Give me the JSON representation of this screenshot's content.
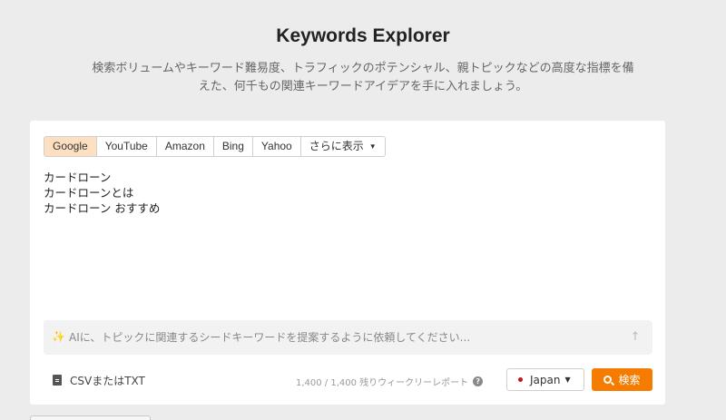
{
  "header": {
    "title": "Keywords Explorer",
    "subtitle_line1": "検索ボリュームやキーワード難易度、トラフィックのポテンシャル、親トピックなどの高度な指標を備",
    "subtitle_line2": "えた、何千もの関連キーワードアイデアを手に入れましょう。"
  },
  "search_engines": {
    "active": "Google",
    "tabs": [
      {
        "label": "Google"
      },
      {
        "label": "YouTube"
      },
      {
        "label": "Amazon"
      },
      {
        "label": "Bing"
      },
      {
        "label": "Yahoo"
      },
      {
        "label": "さらに表示"
      }
    ]
  },
  "keywords": [
    "カードローン",
    "カードローンとは",
    "カードローン おすすめ"
  ],
  "ai_prompt": {
    "placeholder": "AIに、トピックに関連するシードキーワードを提案するように依頼してください..."
  },
  "footer": {
    "csv_label": "CSVまたはTXT",
    "quota_text": "1,400 / 1,400 残りウィークリーレポート",
    "country": "Japan",
    "search_label": "検索"
  },
  "colors": {
    "accent": "#f57c00",
    "active_tab": "#fde0c2",
    "background": "#ececec"
  }
}
